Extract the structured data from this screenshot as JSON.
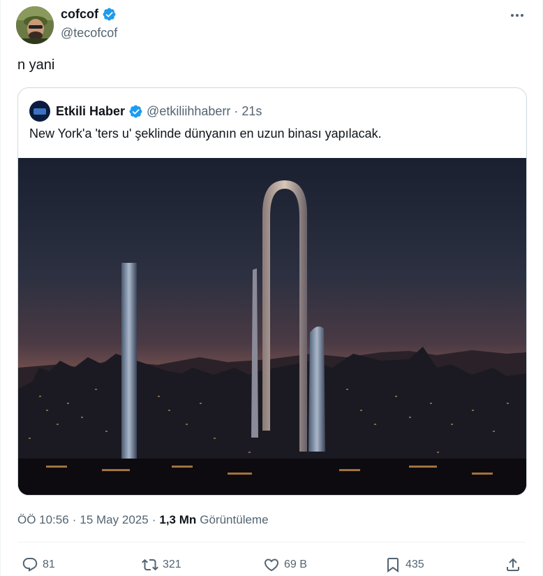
{
  "author": {
    "display_name": "cofcof",
    "handle": "@tecofcof",
    "verified_icon": "verified-badge-icon"
  },
  "tweet": {
    "text": "n yani"
  },
  "quoted": {
    "display_name": "Etkili Haber",
    "handle": "@etkiliihhaberr",
    "separator": "·",
    "time": "21s",
    "text": "New York'a 'ters u' şeklinde dünyanın en uzun binası yapılacak."
  },
  "meta": {
    "time": "ÖÖ 10:56",
    "sep1": "·",
    "date": "15 May 2025",
    "sep2": "·",
    "views_count": "1,3 Mn",
    "views_label": "Görüntüleme"
  },
  "actions": {
    "replies": "81",
    "reposts": "321",
    "likes": "69 B",
    "bookmarks": "435"
  },
  "colors": {
    "verified": "#1d9bf0",
    "muted": "#536471",
    "text": "#0f1419",
    "border": "#cfd9de"
  }
}
